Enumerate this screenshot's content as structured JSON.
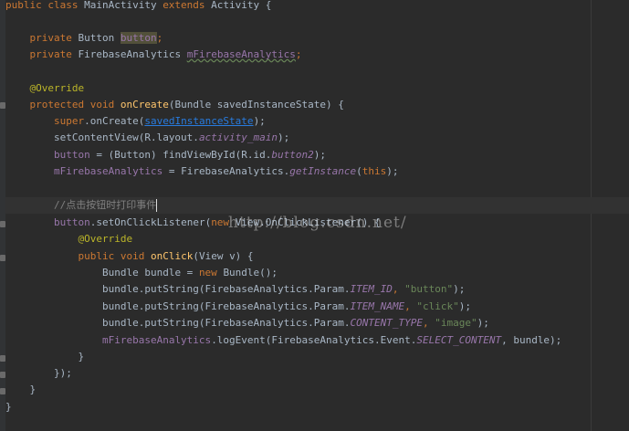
{
  "code": {
    "l1": {
      "kw1": "public class ",
      "class_name": "MainActivity ",
      "kw2": "extends ",
      "super_name": "Activity {"
    },
    "l3": {
      "kw": "private ",
      "type": "Button ",
      "field": "button",
      "semi": ";"
    },
    "l4": {
      "kw": "private ",
      "type": "FirebaseAnalytics ",
      "field": "mFirebaseAnalytics",
      "semi": ";"
    },
    "l6": {
      "annotation": "@Override"
    },
    "l7": {
      "kw": "protected void ",
      "method": "onCreate",
      "rest": "(Bundle savedInstanceState) {"
    },
    "l8": {
      "kw": "super",
      "call": ".onCreate(",
      "arg": "savedInstanceState",
      "end": ");"
    },
    "l9": {
      "text": "setContentView(R.layout.",
      "static": "activity_main",
      "end": ");"
    },
    "l10": {
      "field": "button",
      "mid": " = (Button) findViewById(R.id.",
      "static": "button2",
      "end": ");"
    },
    "l11": {
      "field": "mFirebaseAnalytics",
      "mid": " = FirebaseAnalytics.",
      "static": "getInstance",
      "open": "(",
      "kw": "this",
      "end": ");"
    },
    "l13": {
      "comment": "//点击按钮时打印事件"
    },
    "l14": {
      "field": "button",
      "mid": ".setOnClickListener(",
      "kw": "new ",
      "rest": "View.OnClickListener() {"
    },
    "l15": {
      "annotation": "@Override"
    },
    "l16": {
      "kw": "public void ",
      "method": "onClick",
      "rest": "(View v) {"
    },
    "l17": {
      "text": "Bundle bundle = ",
      "kw": "new ",
      "rest": "Bundle();"
    },
    "l18": {
      "text": "bundle.putString(FirebaseAnalytics.Param.",
      "static": "ITEM_ID",
      "comma": ", ",
      "str": "\"button\"",
      "end": ");"
    },
    "l19": {
      "text": "bundle.putString(FirebaseAnalytics.Param.",
      "static": "ITEM_NAME",
      "comma": ", ",
      "str": "\"click\"",
      "end": ");"
    },
    "l20": {
      "text": "bundle.putString(FirebaseAnalytics.Param.",
      "static": "CONTENT_TYPE",
      "comma": ", ",
      "str": "\"image\"",
      "end": ");"
    },
    "l21": {
      "field": "mFirebaseAnalytics",
      "mid": ".logEvent(FirebaseAnalytics.Event.",
      "static": "SELECT_CONTENT",
      "end": ", bundle);"
    },
    "l22": {
      "text": "}"
    },
    "l23": {
      "text": "});"
    },
    "l24": {
      "text": "}"
    },
    "l25": {
      "text": "}"
    }
  },
  "watermark": "http://blog.csdn.net/",
  "colors": {
    "background": "#2b2b2b",
    "keyword": "#cc7832",
    "method": "#ffc66d",
    "field": "#9876aa",
    "string": "#6a8759",
    "annotation": "#bbb529",
    "comment": "#808080",
    "text": "#a9b7c6"
  }
}
